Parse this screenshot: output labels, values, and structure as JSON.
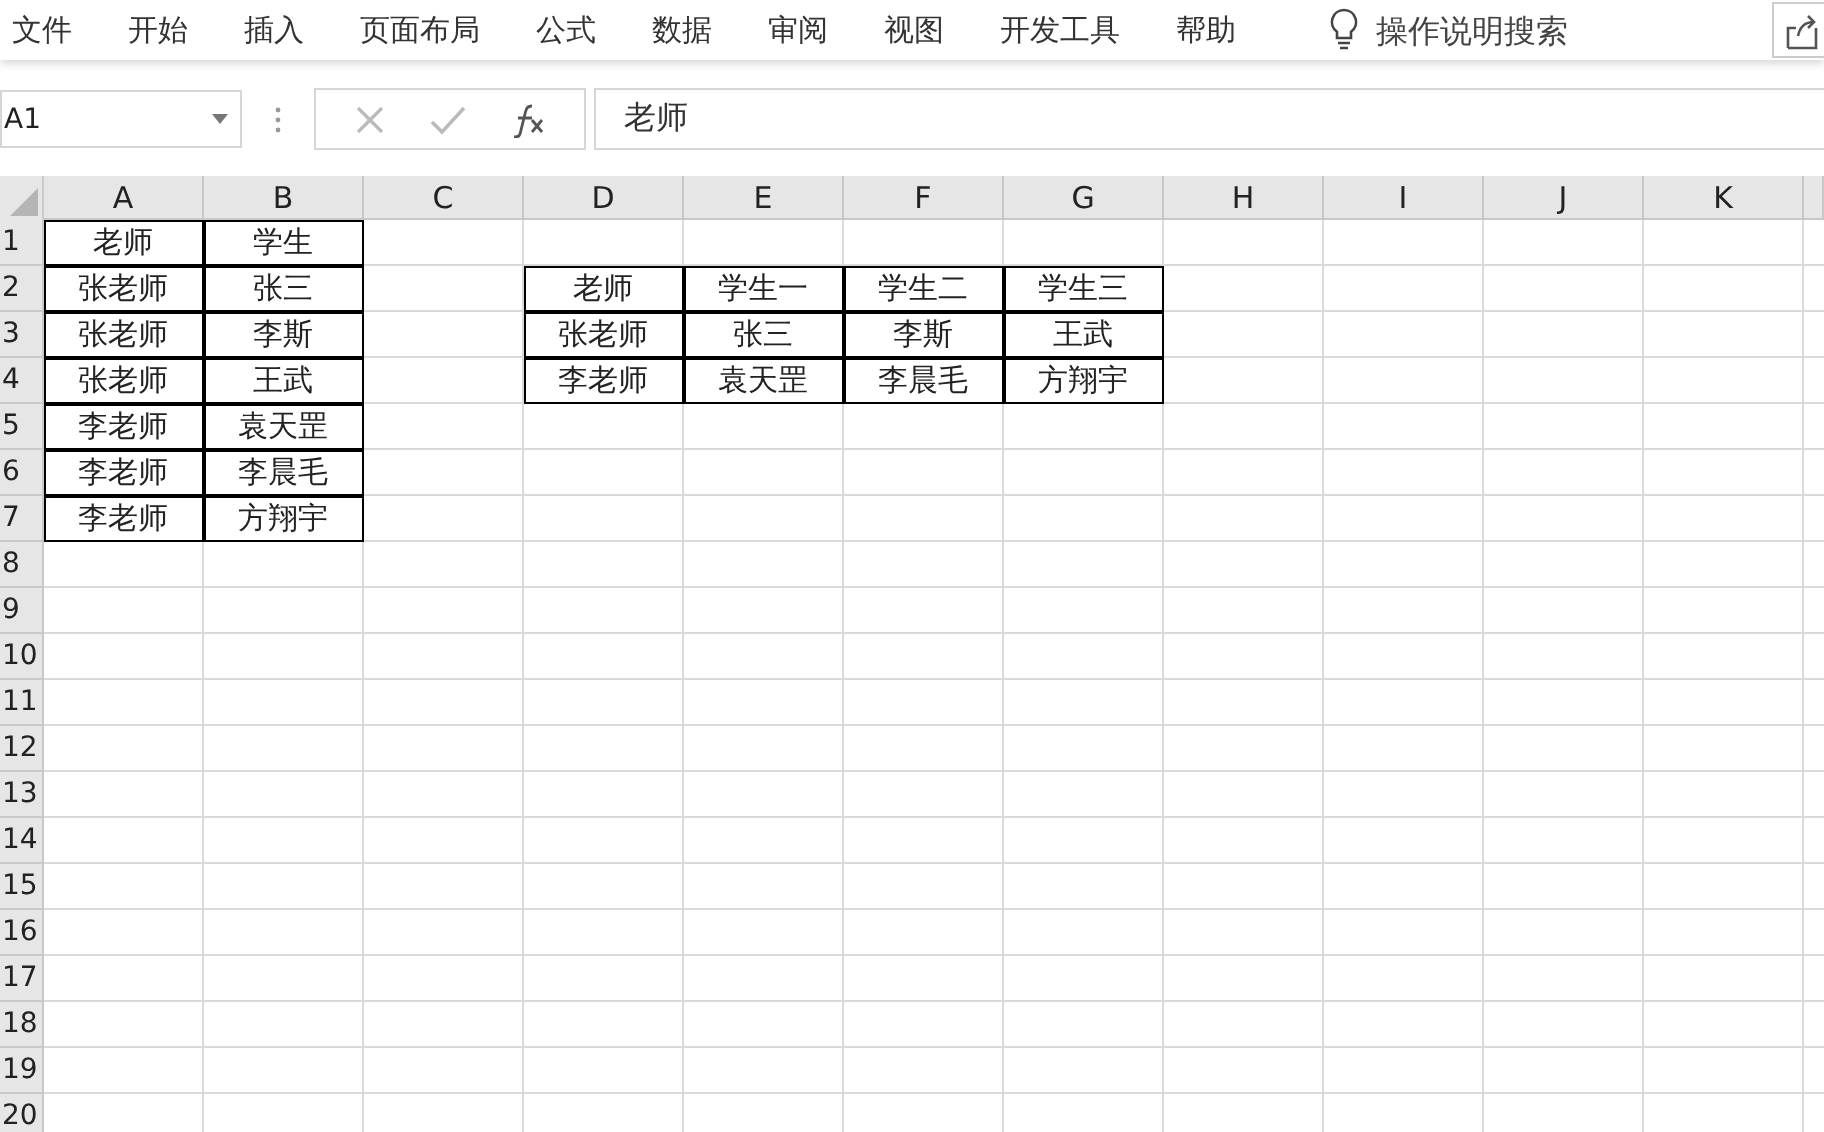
{
  "menu": [
    "文件",
    "开始",
    "插入",
    "页面布局",
    "公式",
    "数据",
    "审阅",
    "视图",
    "开发工具",
    "帮助"
  ],
  "tell_me": {
    "placeholder": "操作说明搜索"
  },
  "name_box": {
    "value": "A1"
  },
  "formula_bar": {
    "value": "老师"
  },
  "columns": [
    "A",
    "B",
    "C",
    "D",
    "E",
    "F",
    "G",
    "H",
    "I",
    "J",
    "K"
  ],
  "rows": [
    {
      "label": "1",
      "cells": [
        "老师",
        "学生"
      ]
    },
    {
      "label": "2",
      "cells": [
        "张老师",
        "张三",
        null,
        "老师",
        "学生一",
        "学生二",
        "学生三"
      ]
    },
    {
      "label": "3",
      "cells": [
        "张老师",
        "李斯",
        null,
        "张老师",
        "张三",
        "李斯",
        "王武"
      ]
    },
    {
      "label": "4",
      "cells": [
        "张老师",
        "王武",
        null,
        "李老师",
        "袁天罡",
        "李晨毛",
        "方翔宇"
      ]
    },
    {
      "label": "5",
      "cells": [
        "李老师",
        "袁天罡"
      ]
    },
    {
      "label": "6",
      "cells": [
        "李老师",
        "李晨毛"
      ]
    },
    {
      "label": "7",
      "cells": [
        "李老师",
        "方翔宇"
      ]
    },
    {
      "label": "8"
    },
    {
      "label": "9"
    },
    {
      "label": "10"
    },
    {
      "label": "11"
    },
    {
      "label": "12"
    },
    {
      "label": "13"
    },
    {
      "label": "14"
    },
    {
      "label": "15"
    },
    {
      "label": "16"
    },
    {
      "label": "17"
    },
    {
      "label": "18"
    },
    {
      "label": "19"
    },
    {
      "label": "20"
    }
  ]
}
